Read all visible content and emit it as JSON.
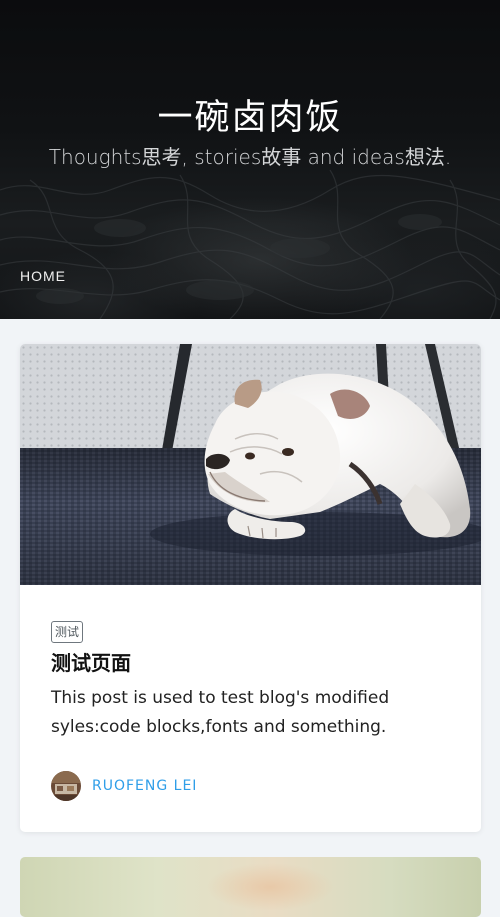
{
  "site": {
    "title": "一碗卤肉饭",
    "subtitle": "Thoughts思考, stories故事 and ideas想法."
  },
  "nav": {
    "home_label": "HOME"
  },
  "posts": [
    {
      "tag": "测试",
      "title": "测试页面",
      "excerpt": "This post is used to test blog's modified syles:code blocks,fonts and something.",
      "author": "RUOFENG LEI",
      "cover_icon": "bulldog-on-carpet-photo"
    }
  ],
  "colors": {
    "hero_bg": "#0f1113",
    "page_bg": "#f1f4f7",
    "card_bg": "#ffffff",
    "author_link": "#2f9ee8",
    "tag_border": "#6f777e"
  }
}
